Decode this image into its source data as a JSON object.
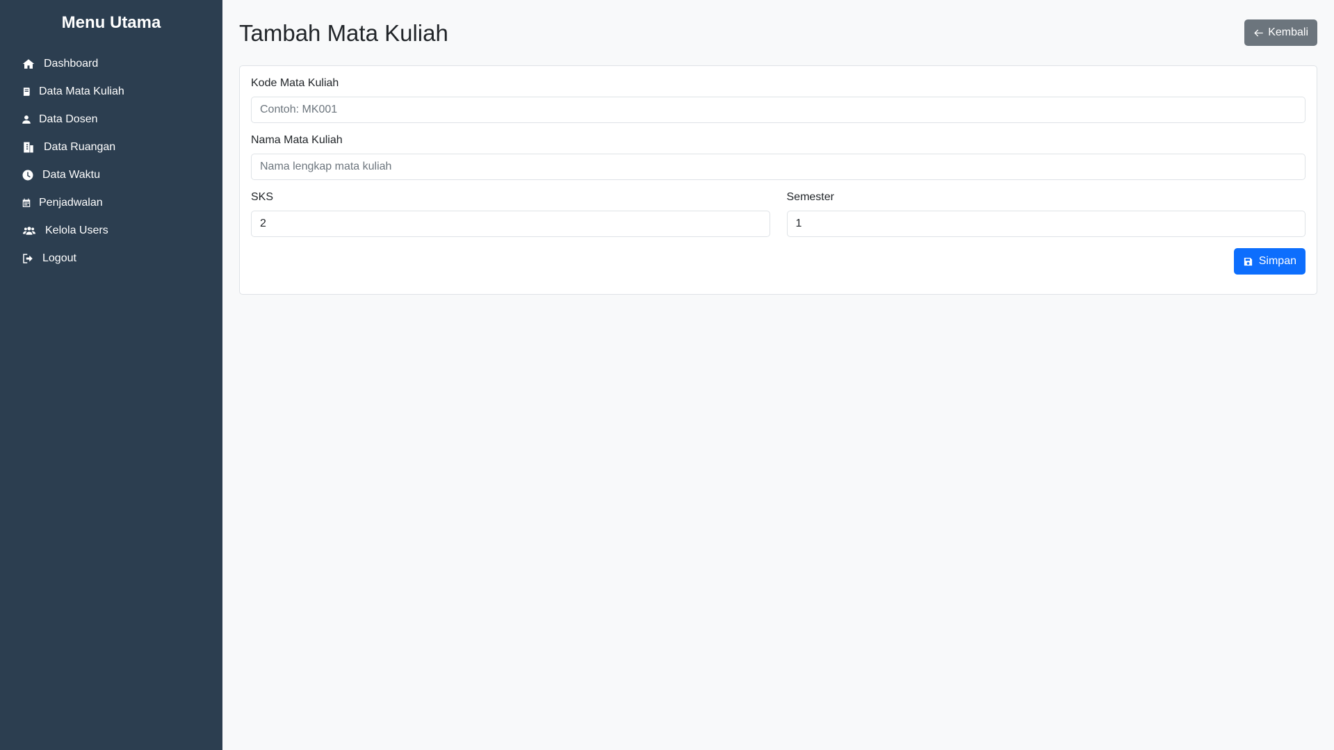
{
  "sidebar": {
    "title": "Menu Utama",
    "items": [
      {
        "label": "Dashboard",
        "icon": "home-icon"
      },
      {
        "label": "Data Mata Kuliah",
        "icon": "book-icon"
      },
      {
        "label": "Data Dosen",
        "icon": "user-tie-icon"
      },
      {
        "label": "Data Ruangan",
        "icon": "building-icon"
      },
      {
        "label": "Data Waktu",
        "icon": "clock-icon"
      },
      {
        "label": "Penjadwalan",
        "icon": "calendar-icon"
      },
      {
        "label": "Kelola Users",
        "icon": "users-icon"
      },
      {
        "label": "Logout",
        "icon": "logout-icon"
      }
    ]
  },
  "header": {
    "title": "Tambah Mata Kuliah",
    "back_label": "Kembali"
  },
  "form": {
    "kode": {
      "label": "Kode Mata Kuliah",
      "placeholder": "Contoh: MK001",
      "value": ""
    },
    "nama": {
      "label": "Nama Mata Kuliah",
      "placeholder": "Nama lengkap mata kuliah",
      "value": ""
    },
    "sks": {
      "label": "SKS",
      "value": "2"
    },
    "semester": {
      "label": "Semester",
      "value": "1"
    },
    "save_label": "Simpan"
  },
  "colors": {
    "sidebar_bg": "#2c3e50",
    "primary": "#0d6efd",
    "secondary": "#6c757d",
    "page_bg": "#f8f9fa"
  }
}
